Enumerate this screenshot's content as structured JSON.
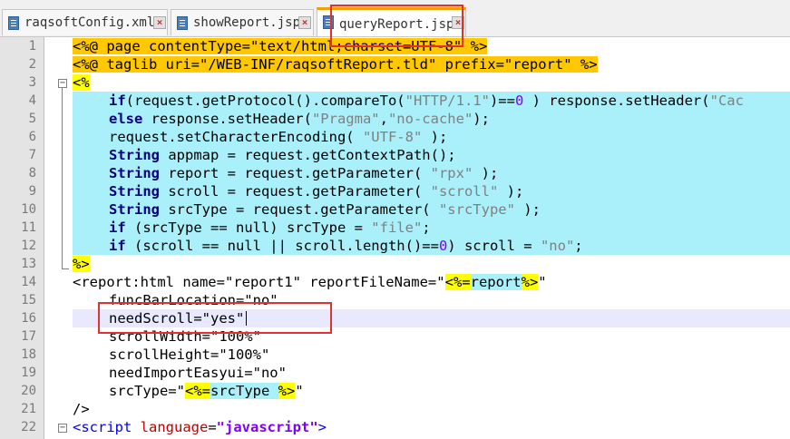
{
  "tabs": [
    {
      "label": "raqsoftConfig.xml"
    },
    {
      "label": "showReport.jsp"
    },
    {
      "label": "queryReport.jsp"
    }
  ],
  "editor": {
    "line_numbers": [
      "1",
      "2",
      "3",
      "4",
      "5",
      "6",
      "7",
      "8",
      "9",
      "10",
      "11",
      "12",
      "13",
      "14",
      "15",
      "16",
      "17",
      "18",
      "19",
      "20",
      "21",
      "22"
    ],
    "code": {
      "l1_a": "<%@",
      "l1_b": " page contentType=\"text/html;charset=UTF-8\" ",
      "l1_c": "%>",
      "l2_a": "<%@",
      "l2_b": " taglib uri=\"/WEB-INF/raqsoftReport.tld\" prefix=\"report\" ",
      "l2_c": "%>",
      "l3": "<%",
      "l4_if": "if",
      "l4_a": "(request.getProtocol().compareTo(",
      "l4_str": "\"HTTP/1.1\"",
      "l4_b": ")==",
      "l4_num": "0",
      "l4_c": " ) response.setHeader(",
      "l4_str2": "\"Cac",
      "l5_else": "else",
      "l5_a": " response.setHeader(",
      "l5_s1": "\"Pragma\"",
      "l5_b": ",",
      "l5_s2": "\"no-cache\"",
      "l5_c": ");",
      "l6_a": "request.setCharacterEncoding( ",
      "l6_s": "\"UTF-8\"",
      "l6_b": " );",
      "l7_kw": "String",
      "l7_a": " appmap = request.getContextPath();",
      "l8_kw": "String",
      "l8_a": " report = request.getParameter( ",
      "l8_s": "\"rpx\"",
      "l8_b": " );",
      "l9_kw": "String",
      "l9_a": " scroll = request.getParameter( ",
      "l9_s": "\"scroll\"",
      "l9_b": " );",
      "l10_kw": "String",
      "l10_a": " srcType = request.getParameter( ",
      "l10_s": "\"srcType\"",
      "l10_b": " );",
      "l11_kw": "if",
      "l11_a": " (srcType == null) srcType = ",
      "l11_s": "\"file\"",
      "l11_b": ";",
      "l12_kw": "if",
      "l12_a": " (scroll == null || scroll.length()==",
      "l12_num": "0",
      "l12_b": ") scroll = ",
      "l12_s": "\"no\"",
      "l12_c": ";",
      "l13": "%>",
      "l14_a": "<report:html name=\"report1\" reportFileName=\"",
      "l14_b": "<%=",
      "l14_c": "report",
      "l14_d": "%>",
      "l14_e": "\"",
      "l15": "funcBarLocation=\"no\"",
      "l16": "needScroll=\"yes\"",
      "l17": "scrollWidth=\"100%\"",
      "l18": "scrollHeight=\"100%\"",
      "l19": "needImportEasyui=\"no\"",
      "l20_a": "srcType=\"",
      "l20_b": "<%=",
      "l20_c": "srcType ",
      "l20_d": "%>",
      "l20_e": "\"",
      "l21": "/>",
      "l22_a": "<script",
      "l22_b": " language",
      "l22_c": "=",
      "l22_d": "\"javascript\"",
      "l22_e": ">"
    }
  },
  "colors": {
    "jsp_directive_bg": "#ffc800",
    "scriptlet_bg": "#aaf0fa",
    "delimiter_bg": "#ffff00",
    "annotation_box": "#e53030"
  }
}
